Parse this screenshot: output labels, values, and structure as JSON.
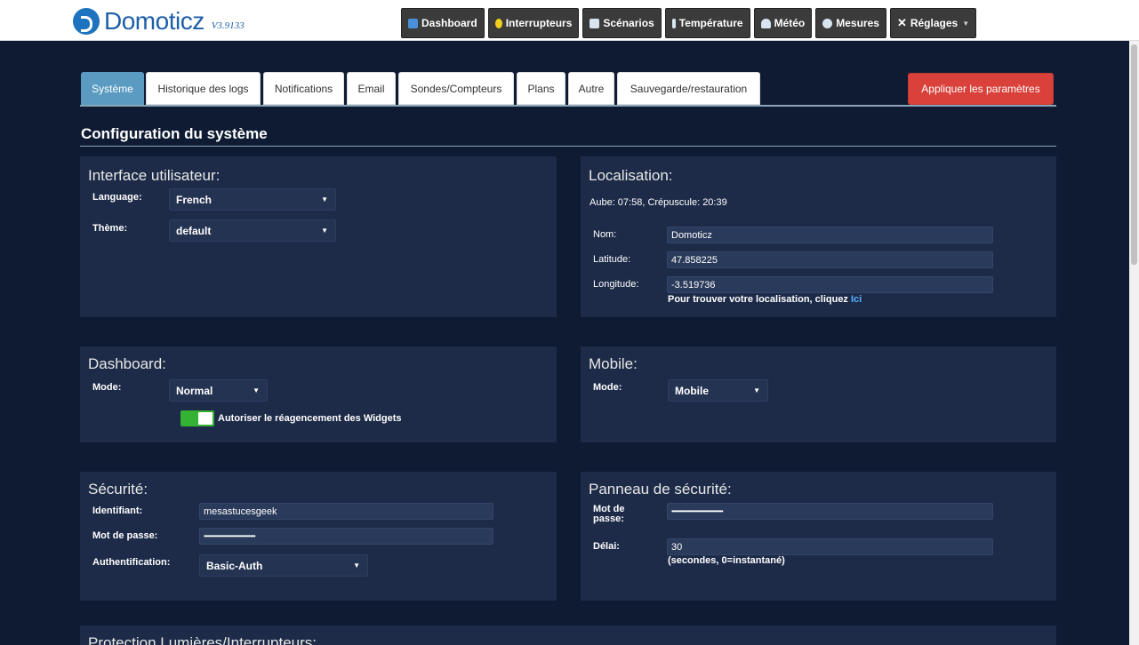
{
  "app": {
    "name": "Domoticz",
    "version": "V3.9133"
  },
  "nav": [
    {
      "label": "Dashboard",
      "icon": "dashboard-icon",
      "color": "#4a90d9"
    },
    {
      "label": "Interrupteurs",
      "icon": "lightbulb-icon",
      "color": "#f2d01b"
    },
    {
      "label": "Scénarios",
      "icon": "scenes-icon",
      "color": "#d8e4f0"
    },
    {
      "label": "Température",
      "icon": "thermometer-icon",
      "color": "#d8e4f0"
    },
    {
      "label": "Météo",
      "icon": "cloud-icon",
      "color": "#d8e4f0"
    },
    {
      "label": "Mesures",
      "icon": "gauge-icon",
      "color": "#d8e4f0"
    },
    {
      "label": "Réglages",
      "icon": "tools-icon",
      "color": "#d8e4f0"
    }
  ],
  "tabs": [
    "Système",
    "Historique des logs",
    "Notifications",
    "Email",
    "Sondes/Compteurs",
    "Plans",
    "Autre",
    "Sauvegarde/restauration"
  ],
  "apply_label": "Appliquer les paramètres",
  "page_title": "Configuration du système",
  "ui_panel": {
    "title": "Interface utilisateur:",
    "language_label": "Language:",
    "language_value": "French",
    "theme_label": "Thème:",
    "theme_value": "default"
  },
  "location": {
    "title": "Localisation:",
    "sun_info": "Aube: 07:58, Crépuscule: 20:39",
    "name_label": "Nom:",
    "name_value": "Domoticz",
    "lat_label": "Latitude:",
    "lat_value": "47.858225",
    "lon_label": "Longitude:",
    "lon_value": "-3.519736",
    "hint": "Pour trouver votre localisation, cliquez",
    "hint_link": "Ici"
  },
  "dashboard": {
    "title": "Dashboard:",
    "mode_label": "Mode:",
    "mode_value": "Normal",
    "rearrange_label": "Autoriser le réagencement des Widgets",
    "rearrange_enabled": true
  },
  "mobile": {
    "title": "Mobile:",
    "mode_label": "Mode:",
    "mode_value": "Mobile"
  },
  "security": {
    "title": "Sécurité:",
    "user_label": "Identifiant:",
    "user_value": "mesastucesgeek",
    "pass_label": "Mot de passe:",
    "pass_value": "••••••••••••••••••••••••••••••••",
    "auth_label": "Authentification:",
    "auth_value": "Basic-Auth"
  },
  "security_panel": {
    "title": "Panneau de sécurité:",
    "pass_label_1": "Mot de",
    "pass_label_2": "passe:",
    "pass_value": "••••••••••••••••••••••••••••••••",
    "delay_label": "Délai:",
    "delay_value": "30",
    "delay_hint": "(secondes, 0=instantané)"
  },
  "next_section_title": "Protection Lumières/Interrupteurs:"
}
